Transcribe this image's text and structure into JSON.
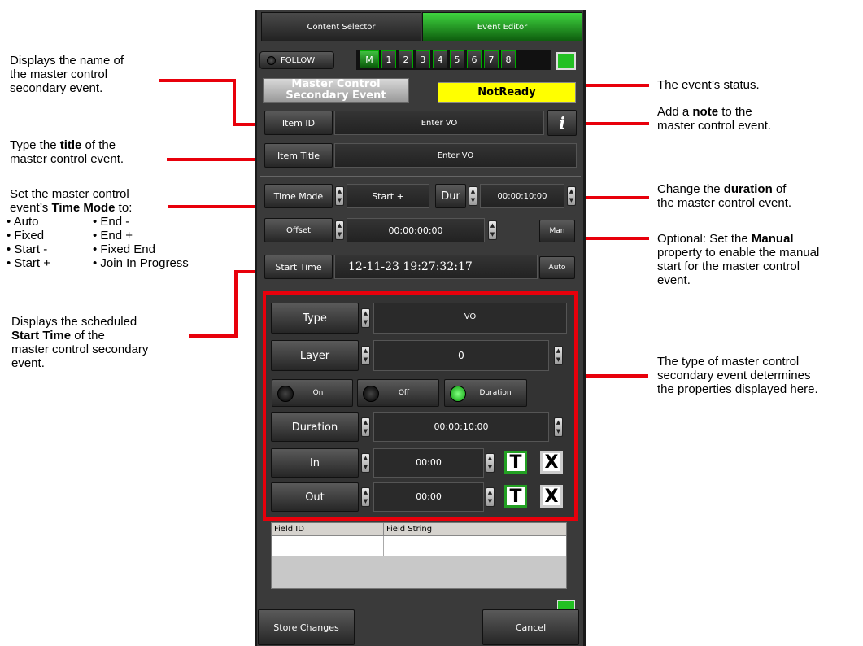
{
  "annotations": {
    "name": "Displays the name of\nthe master control\nsecondary event.",
    "title_pre": "Type the ",
    "title_bold": "title",
    "title_post": " of the\nmaster control event.",
    "timemode_pre": "Set the master control\nevent’s ",
    "timemode_bold": "Time Mode",
    "timemode_post": " to:",
    "modes_left": [
      "• Auto",
      "• Fixed",
      "• Start -",
      "• Start +"
    ],
    "modes_right": [
      "• End -",
      "• End +",
      "• Fixed End",
      "• Join In Progress"
    ],
    "start_line1": "Displays the scheduled",
    "start_bold": "Start Time",
    "start_post": " of the",
    "start_line3": "master control secondary",
    "start_line4": "event.",
    "status": "The event’s status.",
    "note_pre": "Add a ",
    "note_bold": "note",
    "note_post": " to the",
    "note_line2": "master control event.",
    "duration_pre": "Change the ",
    "duration_bold": "duration",
    "duration_post": " of",
    "duration_line2": "the master control event.",
    "manual_pre": "Optional: Set the ",
    "manual_bold": "Manual",
    "manual_line2": "property to enable the manual",
    "manual_line3": "start for the master control",
    "manual_line4": "event.",
    "type_note": "The type of master control\nsecondary event determines\nthe properties displayed here."
  },
  "panel": {
    "tabs": [
      "Content Selector",
      "Event Editor"
    ],
    "follow_label": "FOLLOW",
    "channels": [
      "M",
      "1",
      "2",
      "3",
      "4",
      "5",
      "6",
      "7",
      "8"
    ],
    "event_name": "Master Control\nSecondary Event",
    "status": "NotReady",
    "item_id_label": "Item ID",
    "item_id_value": "Enter VO",
    "info_label": "i",
    "item_title_label": "Item Title",
    "item_title_value": "Enter VO",
    "time_mode_label": "Time Mode",
    "time_mode_value": "Start +",
    "dur_label": "Dur",
    "dur_value": "00:00:10:00",
    "offset_label": "Offset",
    "offset_value": "00:00:00:00",
    "man_label": "Man",
    "start_time_label": "Start Time",
    "start_time_value": "12-11-23 19:27:32:17",
    "auto_label": "Auto",
    "type_label": "Type",
    "type_value": "VO",
    "layer_label": "Layer",
    "layer_value": "0",
    "on_label": "On",
    "off_label": "Off",
    "duration_toggle_label": "Duration",
    "duration_label": "Duration",
    "duration_value": "00:00:10:00",
    "in_label": "In",
    "in_value": "00:00",
    "out_label": "Out",
    "out_value": "00:00",
    "t_label": "T",
    "x_label": "X",
    "table_headers": [
      "Field ID",
      "Field String"
    ],
    "store_label": "Store Changes",
    "cancel_label": "Cancel"
  },
  "colors": {
    "accent_green": "#22c022",
    "status_yellow": "#ffff00",
    "highlight_red": "#e8000b"
  }
}
